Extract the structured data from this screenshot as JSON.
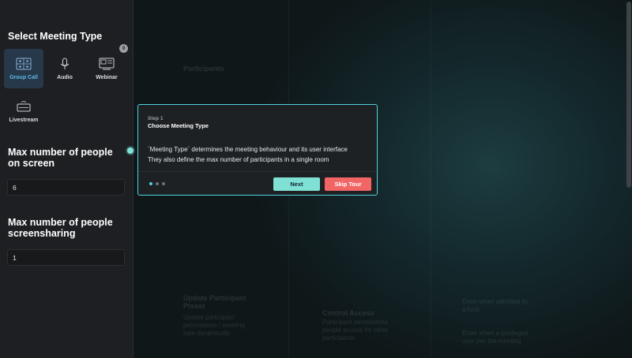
{
  "sidebar": {
    "meeting_type_title": "Select Meeting Type",
    "types": [
      {
        "label": "Group Call",
        "icon": "group-call-icon",
        "selected": true
      },
      {
        "label": "Audio",
        "icon": "microphone-icon",
        "selected": false
      },
      {
        "label": "Webinar",
        "icon": "webinar-icon",
        "selected": false,
        "badge": "0"
      },
      {
        "label": "Livestream",
        "icon": "livestream-icon",
        "selected": false
      }
    ],
    "max_screen_title": "Max number of people on screen",
    "max_screen_value": "6",
    "max_share_title": "Max number of people screensharing",
    "max_share_value": "1"
  },
  "tour": {
    "step": "Step 1",
    "title": "Choose Meeting Type",
    "description_line1": "`Meeting Type` determines the meeting behaviour and its user interface",
    "description_line2": "They also define the max number of participants in a single room",
    "next_label": "Next",
    "skip_label": "Skip Tour",
    "total_steps": 3,
    "current_step": 1
  },
  "background": {
    "items": [
      "Update Participant Preset",
      "Update participant permissions / meeting type dynamically",
      "Control Access",
      "Participant permissions people access for other participants",
      "Enter when admitted by a host",
      "Enter when a privileged user join the meeting",
      "Participants"
    ]
  },
  "colors": {
    "accent": "#4fd4e0",
    "next_button": "#7fe1d4",
    "skip_button": "#f26565",
    "selected_card": "#26384a"
  }
}
